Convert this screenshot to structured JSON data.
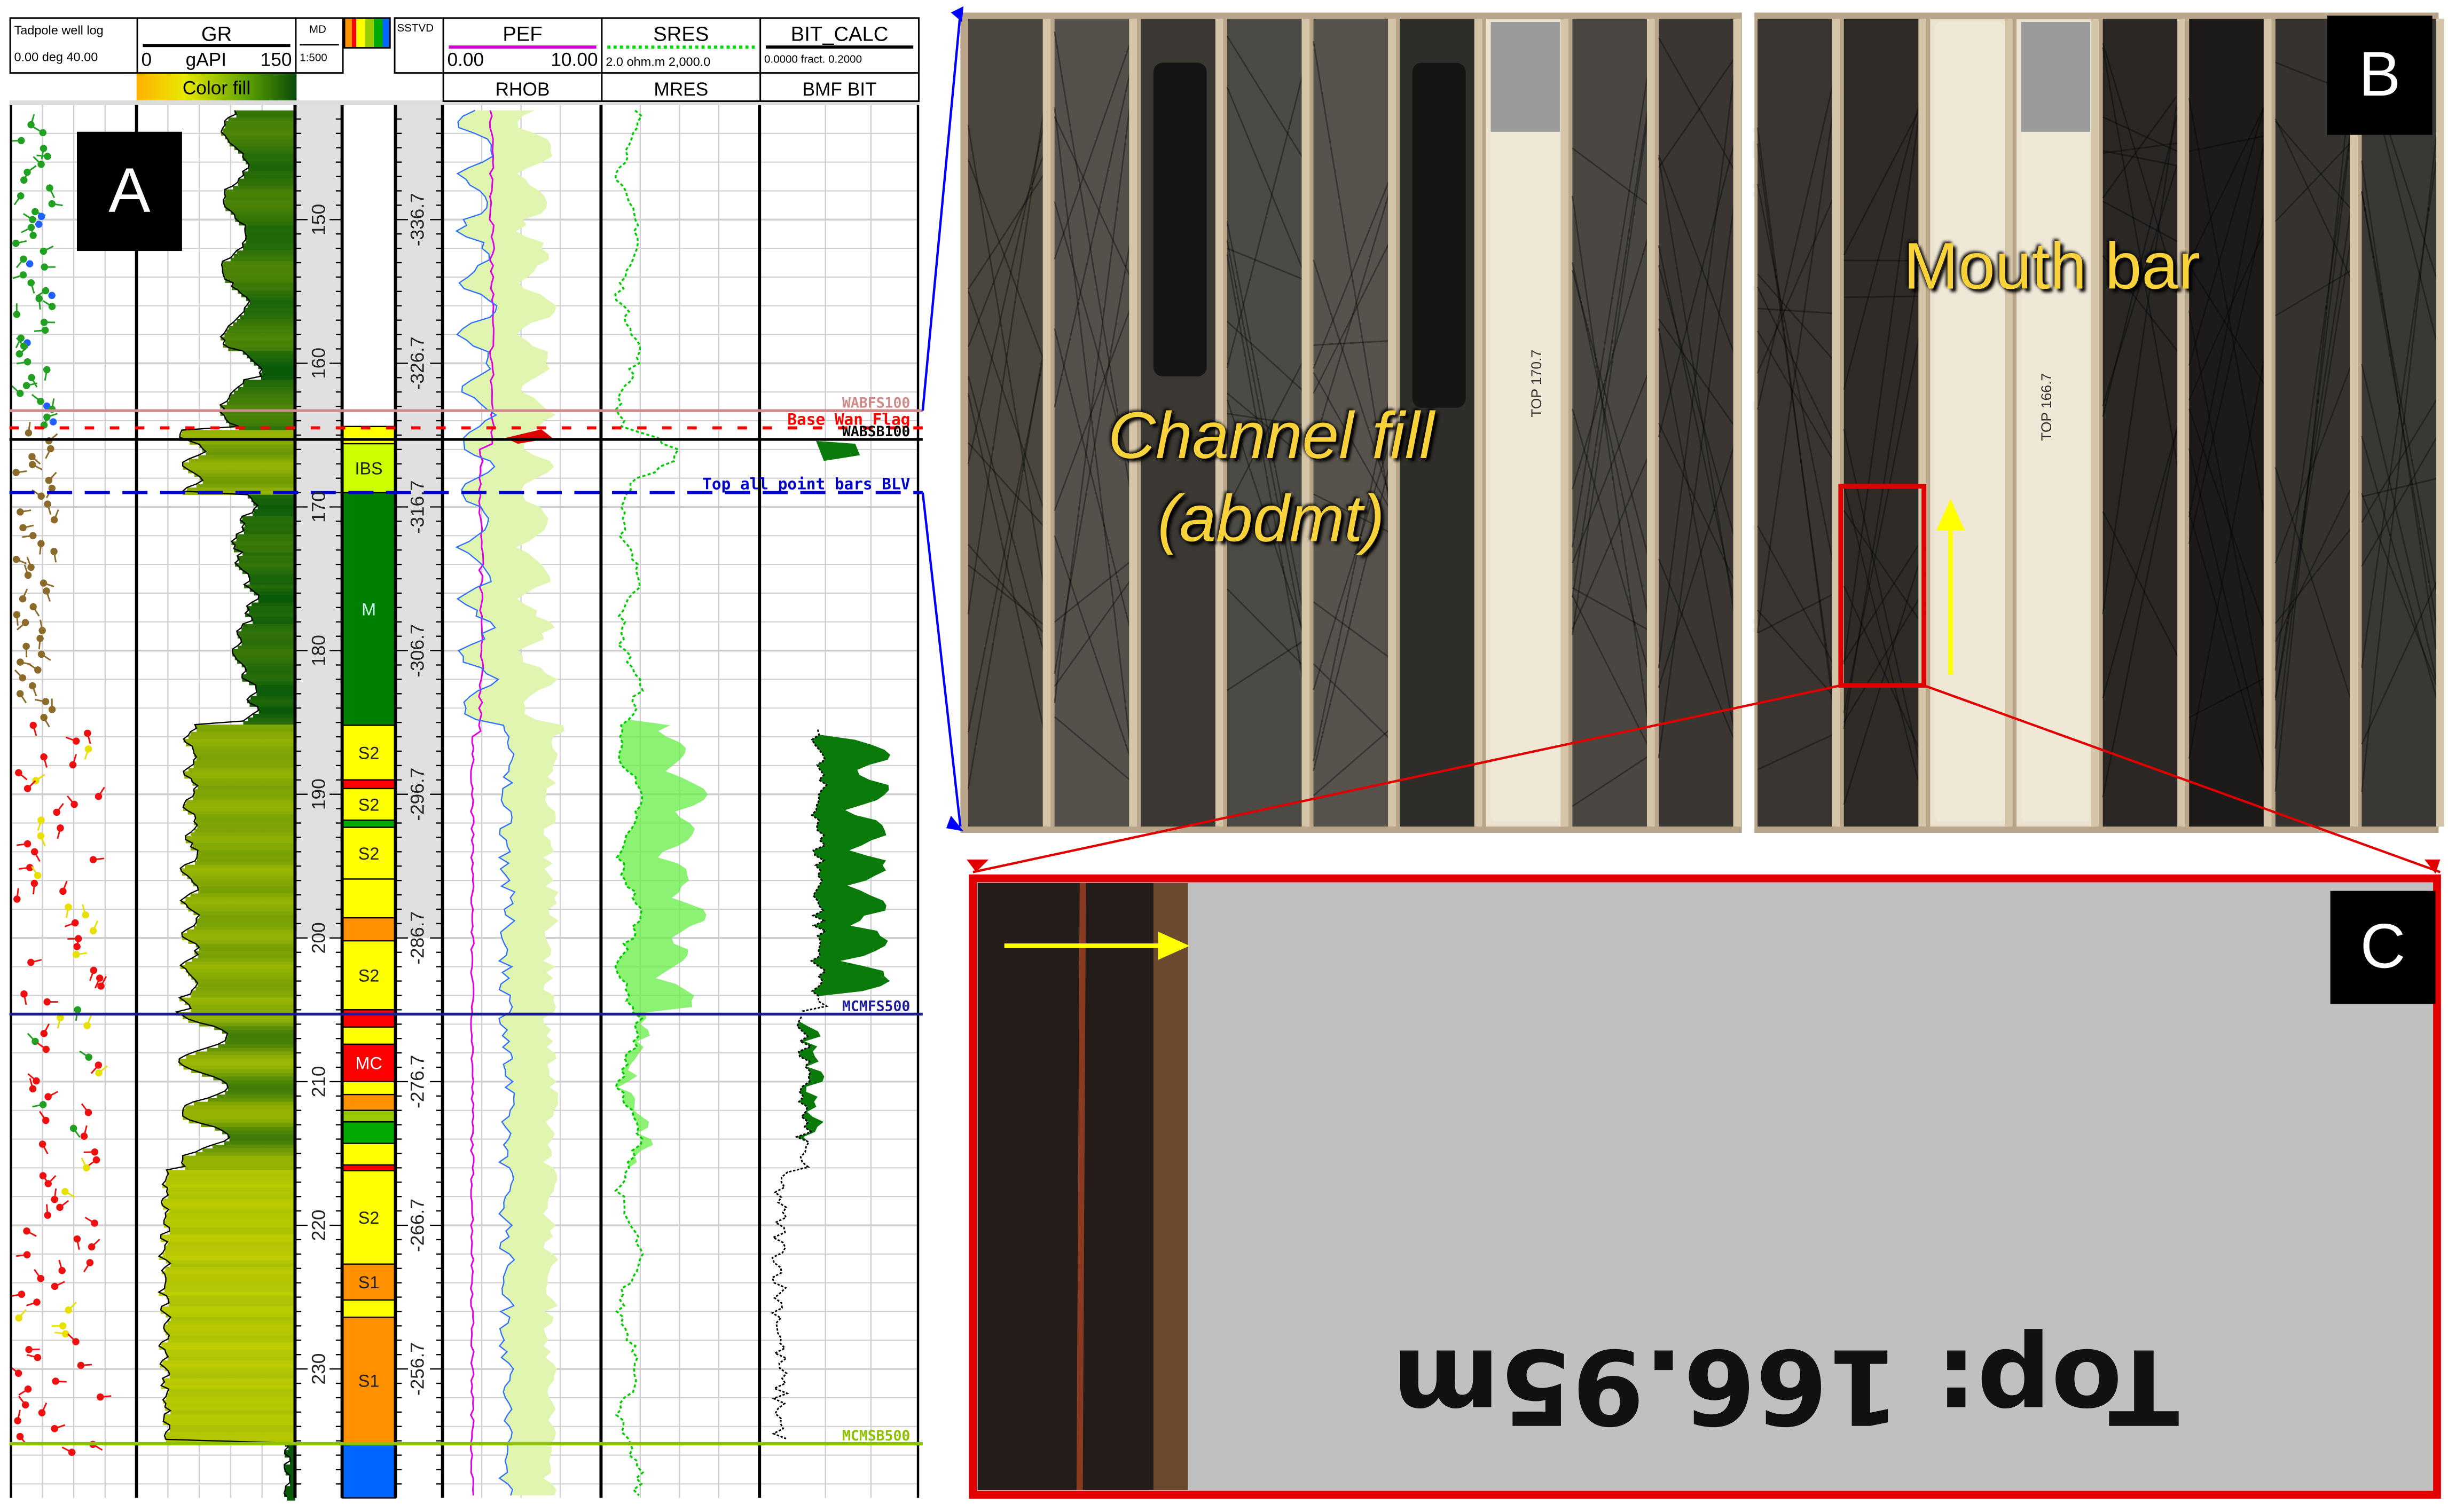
{
  "panel_labels": {
    "a": "A",
    "b": "B",
    "c": "C"
  },
  "log_header": {
    "tadpole": {
      "title": "Tadpole well log",
      "scale": "0.00 deg 40.00"
    },
    "gr": {
      "name": "GR",
      "min": "0",
      "unit": "gAPI",
      "max": "150",
      "fill_label": "Color fill"
    },
    "md": {
      "name": "MD",
      "scale": "1:500"
    },
    "sstvd": {
      "name": "SSTVD"
    },
    "pef": {
      "name": "PEF",
      "min": "0.00",
      "max": "10.00",
      "sub": "RHOB"
    },
    "sres": {
      "name": "SRES",
      "scale": "2.0 ohm.m 2,000.0",
      "sub": "MRES"
    },
    "bit": {
      "name": "BIT_CALC",
      "scale": "0.0000 fract. 0.2000",
      "sub": "BMF  BIT"
    }
  },
  "md_labels": [
    {
      "md": 150,
      "text": "150"
    },
    {
      "md": 160,
      "text": "160"
    },
    {
      "md": 170,
      "text": "170"
    },
    {
      "md": 180,
      "text": "180"
    },
    {
      "md": 190,
      "text": "190"
    },
    {
      "md": 200,
      "text": "200"
    },
    {
      "md": 210,
      "text": "210"
    },
    {
      "md": 220,
      "text": "220"
    },
    {
      "md": 230,
      "text": "230"
    }
  ],
  "sstvd_labels": [
    {
      "md": 150,
      "text": "-336.7"
    },
    {
      "md": 160,
      "text": "-326.7"
    },
    {
      "md": 170,
      "text": "-316.7"
    },
    {
      "md": 180,
      "text": "-306.7"
    },
    {
      "md": 190,
      "text": "-296.7"
    },
    {
      "md": 200,
      "text": "-286.7"
    },
    {
      "md": 210,
      "text": "-276.7"
    },
    {
      "md": 220,
      "text": "-266.7"
    },
    {
      "md": 230,
      "text": "-256.7"
    }
  ],
  "markers": [
    {
      "name": "WABFS100",
      "md": 163.3,
      "color": "#d08a8a",
      "style": "solid"
    },
    {
      "name": "Base Wan Flag",
      "md": 164.5,
      "color": "#ff0000",
      "style": "dashed"
    },
    {
      "name": "WABSB100",
      "md": 165.3,
      "color": "#000000",
      "style": "solid"
    },
    {
      "name": "Top all point bars BLV",
      "md": 169.0,
      "color": "#0000cc",
      "style": "dashed"
    },
    {
      "name": "MCMFS500",
      "md": 205.3,
      "color": "#1a1a99",
      "style": "solid"
    },
    {
      "name": "MCMSB500",
      "md": 235.2,
      "color": "#8cc000",
      "style": "solid"
    }
  ],
  "lithology": [
    {
      "top": 164.4,
      "base": 165.6,
      "color": "#ffff00",
      "label": ""
    },
    {
      "top": 165.6,
      "base": 169.0,
      "color": "#ccff00",
      "label": "IBS"
    },
    {
      "top": 169.0,
      "base": 185.2,
      "color": "#008000",
      "label": "M"
    },
    {
      "top": 185.2,
      "base": 189.0,
      "color": "#ffff00",
      "label": "S2"
    },
    {
      "top": 189.0,
      "base": 189.6,
      "color": "#ff0000",
      "label": ""
    },
    {
      "top": 189.6,
      "base": 191.8,
      "color": "#ffff00",
      "label": "S2"
    },
    {
      "top": 191.8,
      "base": 192.3,
      "color": "#00aa00",
      "label": ""
    },
    {
      "top": 192.3,
      "base": 195.9,
      "color": "#ffff00",
      "label": "S2"
    },
    {
      "top": 195.9,
      "base": 198.6,
      "color": "#ffff00",
      "label": ""
    },
    {
      "top": 198.6,
      "base": 200.2,
      "color": "#ff9000",
      "label": ""
    },
    {
      "top": 200.2,
      "base": 205.0,
      "color": "#ffff00",
      "label": "S2"
    },
    {
      "top": 205.0,
      "base": 206.2,
      "color": "#ff0000",
      "label": ""
    },
    {
      "top": 206.2,
      "base": 207.4,
      "color": "#ffff00",
      "label": ""
    },
    {
      "top": 207.4,
      "base": 210.0,
      "color": "#ff0000",
      "label": "MC"
    },
    {
      "top": 210.0,
      "base": 210.9,
      "color": "#ffff00",
      "label": ""
    },
    {
      "top": 210.9,
      "base": 212.0,
      "color": "#ff9000",
      "label": ""
    },
    {
      "top": 212.0,
      "base": 212.8,
      "color": "#99cc00",
      "label": ""
    },
    {
      "top": 212.8,
      "base": 214.3,
      "color": "#00aa00",
      "label": ""
    },
    {
      "top": 214.3,
      "base": 215.8,
      "color": "#ffff00",
      "label": ""
    },
    {
      "top": 215.8,
      "base": 216.2,
      "color": "#ff0000",
      "label": ""
    },
    {
      "top": 216.2,
      "base": 222.7,
      "color": "#ffff00",
      "label": "S2"
    },
    {
      "top": 222.7,
      "base": 225.2,
      "color": "#ff9000",
      "label": "S1"
    },
    {
      "top": 225.2,
      "base": 226.4,
      "color": "#ffff00",
      "label": ""
    },
    {
      "top": 226.4,
      "base": 235.2,
      "color": "#ff9000",
      "label": "S1"
    },
    {
      "top": 235.2,
      "base": 239.0,
      "color": "#0066ff",
      "label": ""
    }
  ],
  "annotations": {
    "channel_fill_line1": "Channel fill",
    "channel_fill_line2": "(abdmt)",
    "mouth_bar": "Mouth bar",
    "zoom_text": "Top: 166.95m"
  },
  "core_tags": [
    "TOP 170.7",
    "TOP 166.7"
  ],
  "colors": {
    "callout_red": "#e00000",
    "arrow_yellow": "#ffff00",
    "link_blue": "#0000ff",
    "gr_high": "#0a5a0a",
    "gr_low": "#e8e800"
  }
}
